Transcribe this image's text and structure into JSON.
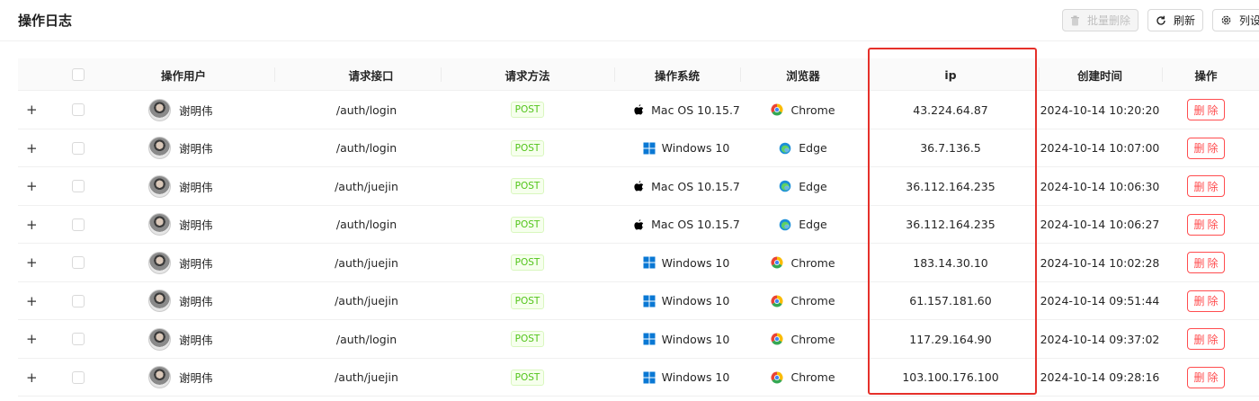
{
  "page": {
    "title": "操作日志"
  },
  "toolbar": {
    "batch_delete": "批量删除",
    "refresh": "刷新",
    "columns": "列设"
  },
  "table": {
    "headers": {
      "user": "操作用户",
      "api": "请求接口",
      "method": "请求方法",
      "os": "操作系统",
      "browser": "浏览器",
      "ip": "ip",
      "created": "创建时间",
      "action": "操作"
    },
    "rows": [
      {
        "user": "谢明伟",
        "api": "/auth/login",
        "method": "POST",
        "os": "Mac OS 10.15.7",
        "os_icon": "apple-icon",
        "browser": "Chrome",
        "browser_icon": "chrome-icon",
        "ip": "43.224.64.87",
        "created": "2024-10-14 10:20:20",
        "action": "删除"
      },
      {
        "user": "谢明伟",
        "api": "/auth/login",
        "method": "POST",
        "os": "Windows 10",
        "os_icon": "windows-icon",
        "browser": "Edge",
        "browser_icon": "edge-icon",
        "ip": "36.7.136.5",
        "created": "2024-10-14 10:07:00",
        "action": "删除"
      },
      {
        "user": "谢明伟",
        "api": "/auth/juejin",
        "method": "POST",
        "os": "Mac OS 10.15.7",
        "os_icon": "apple-icon",
        "browser": "Edge",
        "browser_icon": "edge-icon",
        "ip": "36.112.164.235",
        "created": "2024-10-14 10:06:30",
        "action": "删除"
      },
      {
        "user": "谢明伟",
        "api": "/auth/login",
        "method": "POST",
        "os": "Mac OS 10.15.7",
        "os_icon": "apple-icon",
        "browser": "Edge",
        "browser_icon": "edge-icon",
        "ip": "36.112.164.235",
        "created": "2024-10-14 10:06:27",
        "action": "删除"
      },
      {
        "user": "谢明伟",
        "api": "/auth/juejin",
        "method": "POST",
        "os": "Windows 10",
        "os_icon": "windows-icon",
        "browser": "Chrome",
        "browser_icon": "chrome-icon",
        "ip": "183.14.30.10",
        "created": "2024-10-14 10:02:28",
        "action": "删除"
      },
      {
        "user": "谢明伟",
        "api": "/auth/juejin",
        "method": "POST",
        "os": "Windows 10",
        "os_icon": "windows-icon",
        "browser": "Chrome",
        "browser_icon": "chrome-icon",
        "ip": "61.157.181.60",
        "created": "2024-10-14 09:51:44",
        "action": "删除"
      },
      {
        "user": "谢明伟",
        "api": "/auth/login",
        "method": "POST",
        "os": "Windows 10",
        "os_icon": "windows-icon",
        "browser": "Chrome",
        "browser_icon": "chrome-icon",
        "ip": "117.29.164.90",
        "created": "2024-10-14 09:37:02",
        "action": "删除"
      },
      {
        "user": "谢明伟",
        "api": "/auth/juejin",
        "method": "POST",
        "os": "Windows 10",
        "os_icon": "windows-icon",
        "browser": "Chrome",
        "browser_icon": "chrome-icon",
        "ip": "103.100.176.100",
        "created": "2024-10-14 09:28:16",
        "action": "删除"
      }
    ]
  },
  "colors": {
    "accent_red": "#ff4d4f",
    "highlight_box": "#e5302a",
    "post_tag": "#52c41a"
  }
}
